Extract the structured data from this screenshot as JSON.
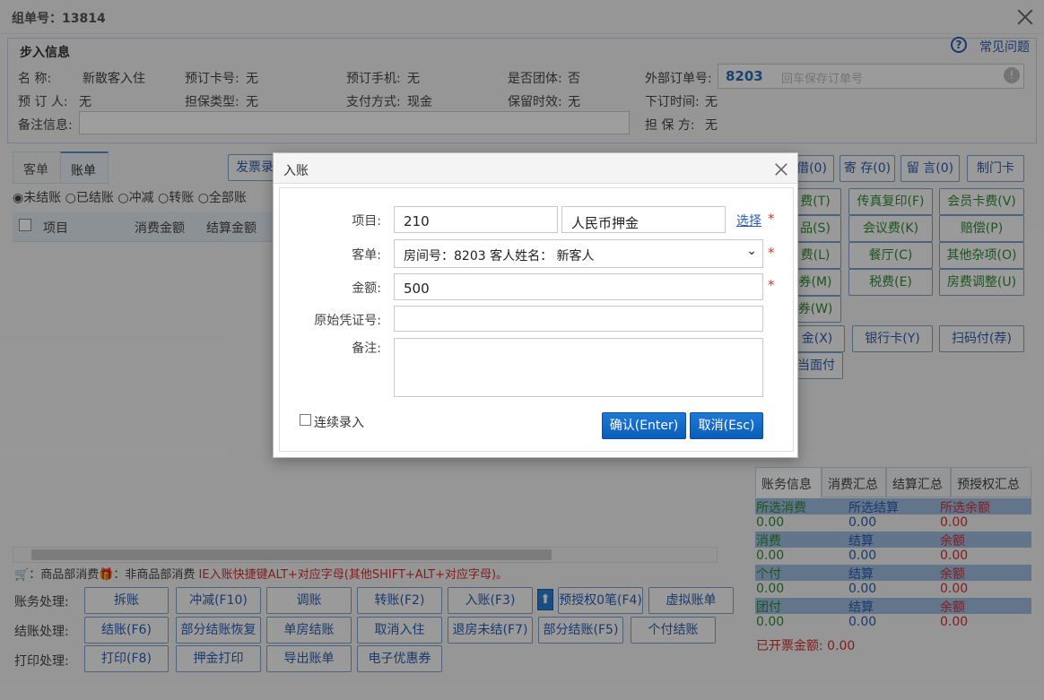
{
  "window": {
    "title": "组单号：13814"
  },
  "info": {
    "legend": "步入信息",
    "help": "常见问题",
    "name_label": "名  称:",
    "name_value": "新散客入住",
    "card_label": "预订卡号:",
    "card_value": "无",
    "phone_label": "预订手机:",
    "phone_value": "无",
    "group_label": "是否团体:",
    "group_value": "否",
    "ext_order_label": "外部订单号:",
    "ext_order_room": "8203",
    "ext_order_placeholder": "回车保存订单号",
    "booker_label": "预 订 人:",
    "booker_value": "无",
    "guarantee_type_label": "担保类型:",
    "guarantee_type_value": "无",
    "pay_label": "支付方式:",
    "pay_value": "现金",
    "retain_label": "保留时效:",
    "retain_value": "无",
    "order_time_label": "下订时间:",
    "order_time_value": "无",
    "remark_label": "备注信息:",
    "guarantor_label": "担 保 方:",
    "guarantor_value": "无"
  },
  "left_tabs": [
    "客单",
    "账单"
  ],
  "invoice_btn": "发票录",
  "filters": [
    "未结账",
    "已结账",
    "冲减",
    "转账",
    "全部账"
  ],
  "grid_cols": [
    "项目",
    "消费金额",
    "结算金额"
  ],
  "top_right_btns": [
    "借(0)",
    "寄 存(0)",
    "留 言(0)",
    "制门卡"
  ],
  "fee_btns": {
    "r1": [
      "费(T)",
      "传真复印(F)",
      "会员卡费(V)"
    ],
    "r2": [
      "品(S)",
      "会议费(K)",
      "赔偿(P)"
    ],
    "r3": [
      "费(L)",
      "餐厅(C)",
      "其他杂项(O)"
    ],
    "r4": [
      "券(M)",
      "税费(E)",
      "房费调整(U)"
    ],
    "r5": [
      "券(W)"
    ],
    "r6": [
      "金(X)",
      "银行卡(Y)",
      "扫码付(荐)"
    ],
    "r7": [
      "当面付"
    ]
  },
  "legend_line": {
    "goods": "：商品部消费",
    "nongoods": "：非商品部消费",
    "tip": "IE入账快捷键ALT+对应字母(其他SHIFT+ALT+对应字母)。"
  },
  "actions": {
    "acc_label": "账务处理:",
    "acc": [
      "拆账",
      "冲减(F10)",
      "调账",
      "转账(F2)",
      "入账(F3)",
      "预授权0笔(F4)",
      "虚拟账单"
    ],
    "settle_label": "结账处理:",
    "settle": [
      "结账(F6)",
      "部分结账恢复",
      "单房结账",
      "取消入住",
      "退房未结(F7)",
      "部分结账(F5)",
      "个付结账"
    ],
    "print_label": "打印处理:",
    "print": [
      "打印(F8)",
      "押金打印",
      "导出账单",
      "电子优惠券"
    ]
  },
  "summary": {
    "tabs": [
      "账务信息",
      "消费汇总",
      "结算汇总",
      "预授权汇总"
    ],
    "rows": [
      {
        "h": [
          "所选消费",
          "所选结算",
          "所选余额"
        ],
        "v": [
          "0.00",
          "0.00",
          "0.00"
        ]
      },
      {
        "h": [
          "消费",
          "结算",
          "余额"
        ],
        "v": [
          "0.00",
          "0.00",
          "0.00"
        ]
      },
      {
        "h": [
          "个付",
          "结算",
          "余额"
        ],
        "v": [
          "0.00",
          "0.00",
          "0.00"
        ]
      },
      {
        "h": [
          "团付",
          "结算",
          "余额"
        ],
        "v": [
          "0.00",
          "0.00",
          "0.00"
        ]
      }
    ],
    "invoiced_label": "已开票金额:",
    "invoiced_value": "0.00"
  },
  "dialog": {
    "title": "入账",
    "item_label": "项目:",
    "item_code": "210",
    "item_name": "人民币押金",
    "select_link": "选择",
    "bill_label": "客单:",
    "bill_value": "房间号：8203 客人姓名： 新客人",
    "amount_label": "金额:",
    "amount_value": "500",
    "voucher_label": "原始凭证号:",
    "voucher_value": "",
    "note_label": "备注:",
    "note_value": "",
    "continuous": "连续录入",
    "ok": "确认(Enter)",
    "cancel": "取消(Esc)"
  },
  "colors": {
    "blue": "#2a5db0",
    "green": "#2f8a36",
    "red": "#d32f2f",
    "primary": "#0a5db8"
  }
}
